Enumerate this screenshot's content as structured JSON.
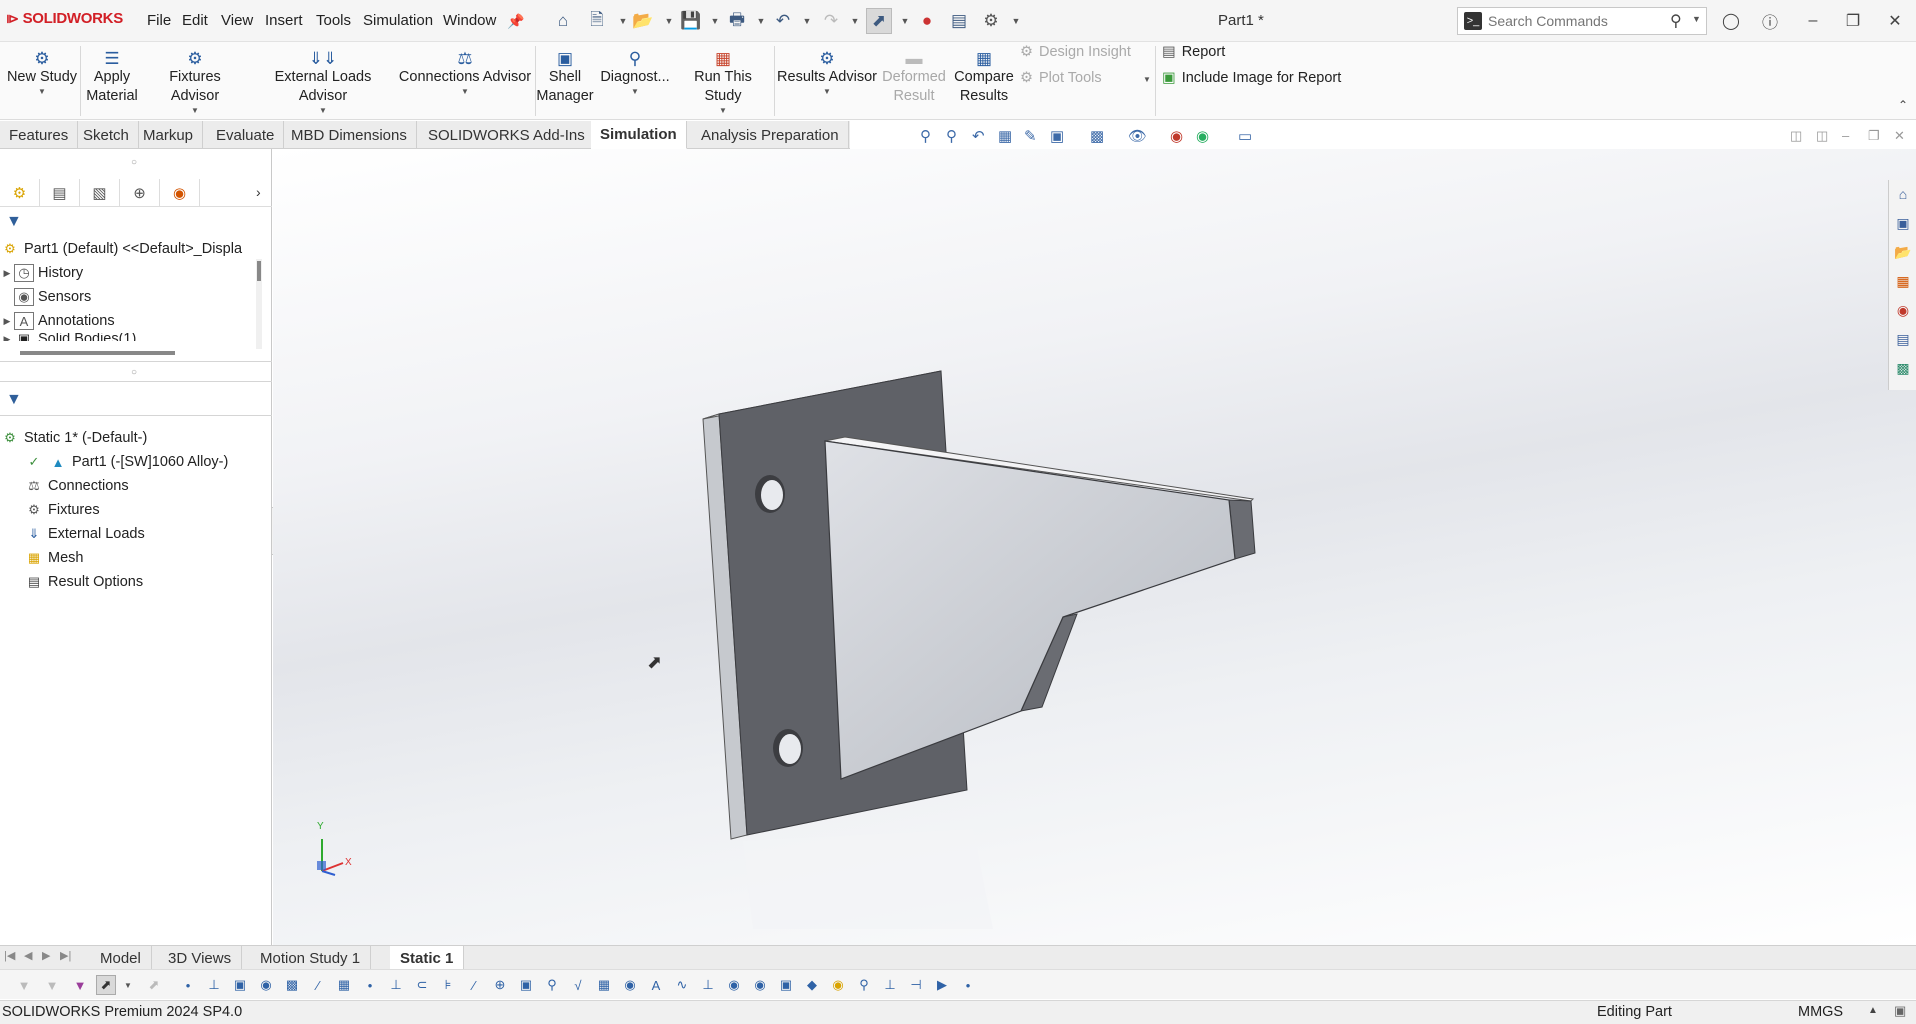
{
  "app": {
    "brand": "SOLIDWORKS",
    "document_title": "Part1 *"
  },
  "menu": [
    "File",
    "Edit",
    "View",
    "Insert",
    "Tools",
    "Simulation",
    "Window"
  ],
  "search": {
    "placeholder": "Search Commands"
  },
  "ribbon": {
    "new_study": "New Study",
    "apply_material_1": "Apply",
    "apply_material_2": "Material",
    "fixtures_advisor": "Fixtures Advisor",
    "external_loads_advisor": "External Loads Advisor",
    "connections_advisor": "Connections Advisor",
    "shell_manager_1": "Shell",
    "shell_manager_2": "Manager",
    "diagnostics": "Diagnost...",
    "run_this_study": "Run This Study",
    "results_advisor": "Results Advisor",
    "deformed_result_1": "Deformed",
    "deformed_result_2": "Result",
    "compare_results_1": "Compare",
    "compare_results_2": "Results",
    "design_insight": "Design Insight",
    "plot_tools": "Plot Tools",
    "report": "Report",
    "include_image": "Include Image for Report"
  },
  "tabs": [
    "Features",
    "Sketch",
    "Markup",
    "Evaluate",
    "MBD Dimensions",
    "SOLIDWORKS Add-Ins",
    "Simulation",
    "Analysis Preparation"
  ],
  "active_tab": "Simulation",
  "feature_tree": {
    "root": "Part1 (Default) <<Default>_Displa",
    "items": [
      "History",
      "Sensors",
      "Annotations",
      "Solid Bodies(1)"
    ]
  },
  "sim_tree": {
    "root": "Static 1* (-Default-)",
    "items": [
      "Part1 (-[SW]1060 Alloy-)",
      "Connections",
      "Fixtures",
      "External Loads",
      "Mesh",
      "Result Options"
    ]
  },
  "triad": {
    "y": "Y",
    "x": "X"
  },
  "bottom_tabs": [
    "Model",
    "3D Views",
    "Motion Study 1",
    "Static 1"
  ],
  "status": {
    "product": "SOLIDWORKS Premium 2024 SP4.0",
    "mode": "Editing Part",
    "units": "MMGS"
  },
  "colors": {
    "brand_red": "#d21f26",
    "accent_blue": "#2a5d9f",
    "part_dark": "#5f6167",
    "part_light": "#c9ccd2"
  }
}
